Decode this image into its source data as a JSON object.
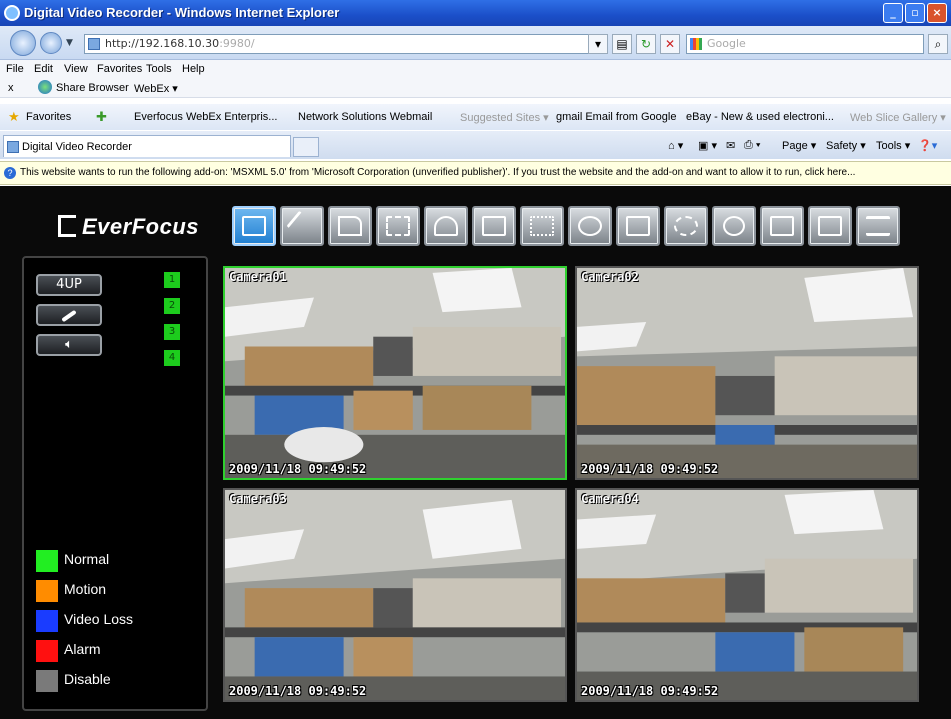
{
  "window": {
    "title": "Digital Video Recorder - Windows Internet Explorer"
  },
  "address": {
    "url_host": "http://192.168.10.30",
    "url_port": ":9980/",
    "search_placeholder": "Google"
  },
  "menu": [
    "File",
    "Edit",
    "View",
    "Favorites",
    "Tools",
    "Help"
  ],
  "links_bar": {
    "close": "x",
    "share": "Share Browser",
    "webex": "WebEx ▾"
  },
  "favorites_bar": {
    "favorites_label": "Favorites",
    "items": [
      "Everfocus WebEx Enterpris...",
      "Network Solutions Webmail",
      "Suggested Sites ▾",
      "gmail Email from Google",
      "eBay - New & used electroni...",
      "Web Slice Gallery ▾"
    ]
  },
  "tabs": {
    "active_tab": "Digital Video Recorder",
    "tools": [
      "Page ▾",
      "Safety ▾",
      "Tools ▾"
    ]
  },
  "infobar": {
    "text": "This website wants to run the following add-on: 'MSXML 5.0' from 'Microsoft Corporation (unverified publisher)'. If you trust the website and the add-on and want to allow it to run, click here..."
  },
  "dvr": {
    "brand": "EverFocus",
    "toolbar_icons": [
      "live-view-icon",
      "setup-wand-icon",
      "camera-icon",
      "record-icon",
      "alarm-bell-icon",
      "schedule-icon",
      "network-icon",
      "backup-icon",
      "display-icon",
      "settings-gear-icon",
      "info-icon",
      "playback-icon",
      "search-icon",
      "ptz-icon"
    ],
    "controls": {
      "layout_button": "4UP",
      "audio_icon": "speaker-icon"
    },
    "channel_numbers": [
      "1",
      "2",
      "3",
      "4"
    ],
    "legend": [
      {
        "label": "Normal",
        "color": "#22ee22"
      },
      {
        "label": "Motion",
        "color": "#ff8c00"
      },
      {
        "label": "Video Loss",
        "color": "#1a3cff"
      },
      {
        "label": "Alarm",
        "color": "#ff1010"
      },
      {
        "label": "Disable",
        "color": "#7a7a7a"
      }
    ],
    "cameras": [
      {
        "name": "Camera01",
        "timestamp": "2009/11/18 09:49:52"
      },
      {
        "name": "Camera02",
        "timestamp": "2009/11/18 09:49:52"
      },
      {
        "name": "Camera03",
        "timestamp": "2009/11/18 09:49:52"
      },
      {
        "name": "Camera04",
        "timestamp": "2009/11/18 09:49:52"
      }
    ]
  }
}
